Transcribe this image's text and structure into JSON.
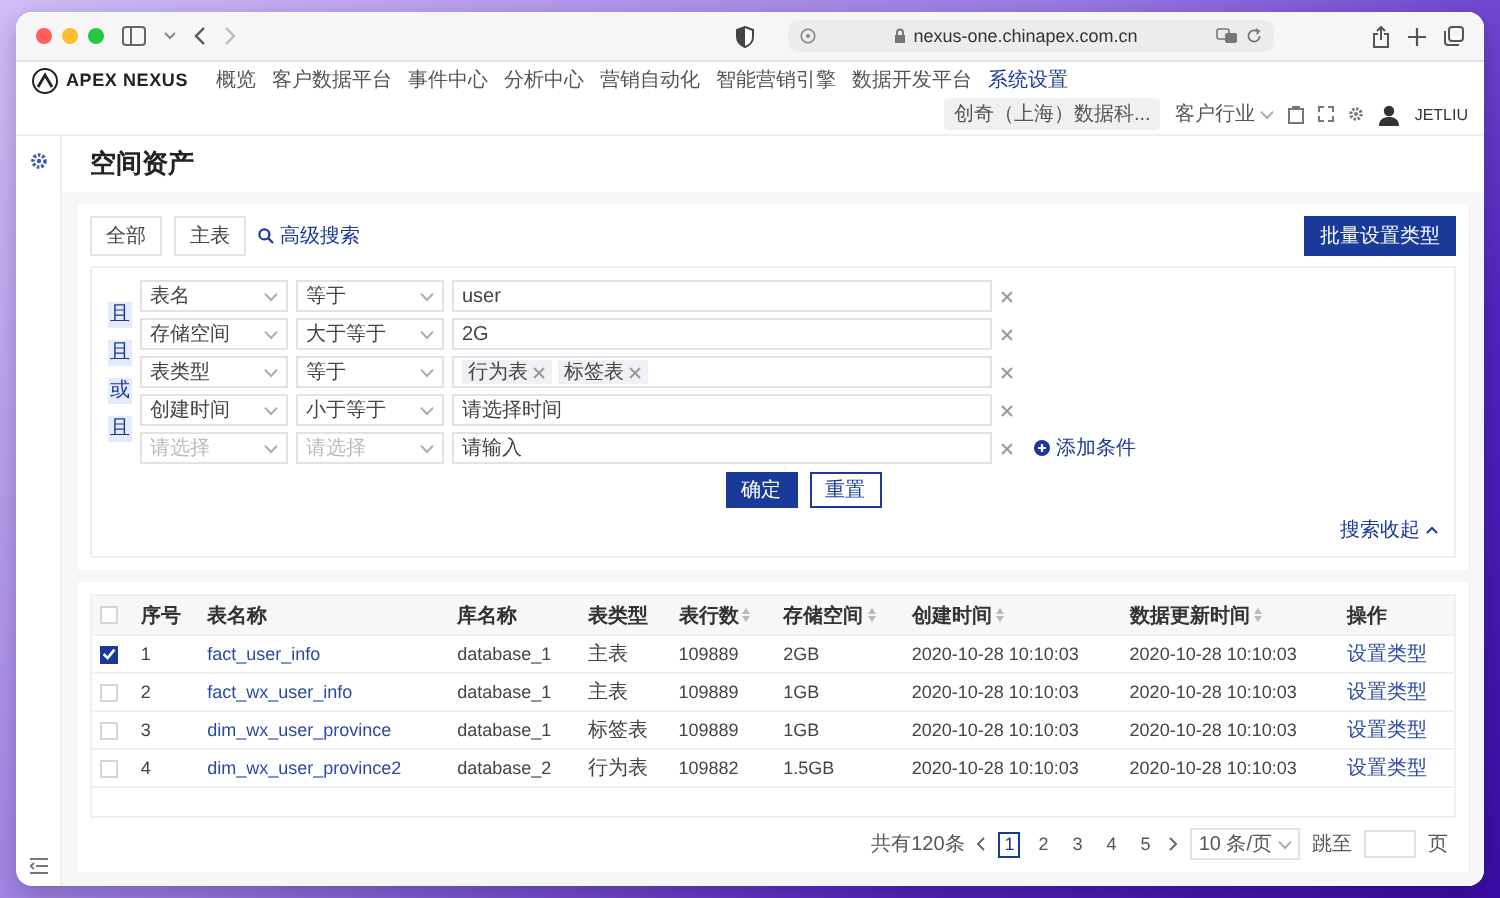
{
  "browser": {
    "url": "nexus-one.chinapex.com.cn"
  },
  "app": {
    "logo": "APEX NEXUS",
    "nav": [
      {
        "label": "概览",
        "selected": false
      },
      {
        "label": "客户数据平台",
        "selected": false
      },
      {
        "label": "事件中心",
        "selected": false
      },
      {
        "label": "分析中心",
        "selected": false
      },
      {
        "label": "营销自动化",
        "selected": false
      },
      {
        "label": "智能营销引擎",
        "selected": false
      },
      {
        "label": "数据开发平台",
        "selected": false
      },
      {
        "label": "系统设置",
        "selected": true
      }
    ],
    "company": "创奇（上海）数据科...",
    "industry": "客户行业",
    "user": "JETLIU"
  },
  "page_title": "空间资产",
  "filter_tabs": [
    {
      "label": "全部",
      "selected": false
    },
    {
      "label": "主表",
      "selected": false
    }
  ],
  "advanced_search": "高级搜索",
  "batch_button": "批量设置类型",
  "filter": {
    "connectors": [
      "且",
      "且",
      "或",
      "且"
    ],
    "conditions": [
      {
        "field": "表名",
        "operator": "等于",
        "value": "user"
      },
      {
        "field": "存储空间",
        "operator": "大于等于",
        "value": "2G"
      },
      {
        "field": "表类型",
        "operator": "等于",
        "tags": [
          "行为表",
          "标签表"
        ]
      },
      {
        "field": "创建时间",
        "operator": "小于等于",
        "value_placeholder": "请选择时间"
      },
      {
        "field_placeholder": "请选择",
        "operator_placeholder": "请选择",
        "value_placeholder": "请输入"
      }
    ],
    "add_condition": "添加条件",
    "confirm": "确定",
    "reset": "重置",
    "collapse": "搜索收起"
  },
  "table": {
    "header_checked": false,
    "columns": [
      {
        "label": "序号",
        "sortable": false
      },
      {
        "label": "表名称",
        "sortable": false
      },
      {
        "label": "库名称",
        "sortable": false
      },
      {
        "label": "表类型",
        "sortable": false
      },
      {
        "label": "表行数",
        "sortable": true
      },
      {
        "label": "存储空间",
        "sortable": true
      },
      {
        "label": "创建时间",
        "sortable": true
      },
      {
        "label": "数据更新时间",
        "sortable": true
      },
      {
        "label": "操作",
        "sortable": false
      }
    ],
    "rows": [
      {
        "checked": true,
        "cells": [
          "1",
          "fact_user_info",
          "database_1",
          "主表",
          "109889",
          "2GB",
          "2020-10-28 10:10:03",
          "2020-10-28 10:10:03",
          "设置类型"
        ]
      },
      {
        "checked": false,
        "cells": [
          "2",
          "fact_wx_user_info",
          "database_1",
          "主表",
          "109889",
          "1GB",
          "2020-10-28 10:10:03",
          "2020-10-28 10:10:03",
          "设置类型"
        ]
      },
      {
        "checked": false,
        "cells": [
          "3",
          "dim_wx_user_province",
          "database_1",
          "标签表",
          "109889",
          "1GB",
          "2020-10-28 10:10:03",
          "2020-10-28 10:10:03",
          "设置类型"
        ]
      },
      {
        "checked": false,
        "cells": [
          "4",
          "dim_wx_user_province2",
          "database_2",
          "行为表",
          "109882",
          "1.5GB",
          "2020-10-28 10:10:03",
          "2020-10-28 10:10:03",
          "设置类型"
        ]
      }
    ]
  },
  "pagination": {
    "total": "共有120条",
    "pages": [
      {
        "label": "1",
        "selected": true
      },
      {
        "label": "2",
        "selected": false
      },
      {
        "label": "3",
        "selected": false
      },
      {
        "label": "4",
        "selected": false
      },
      {
        "label": "5",
        "selected": false
      }
    ],
    "page_size": "10 条/页",
    "jump_label": "跳至",
    "page_unit": "页"
  }
}
